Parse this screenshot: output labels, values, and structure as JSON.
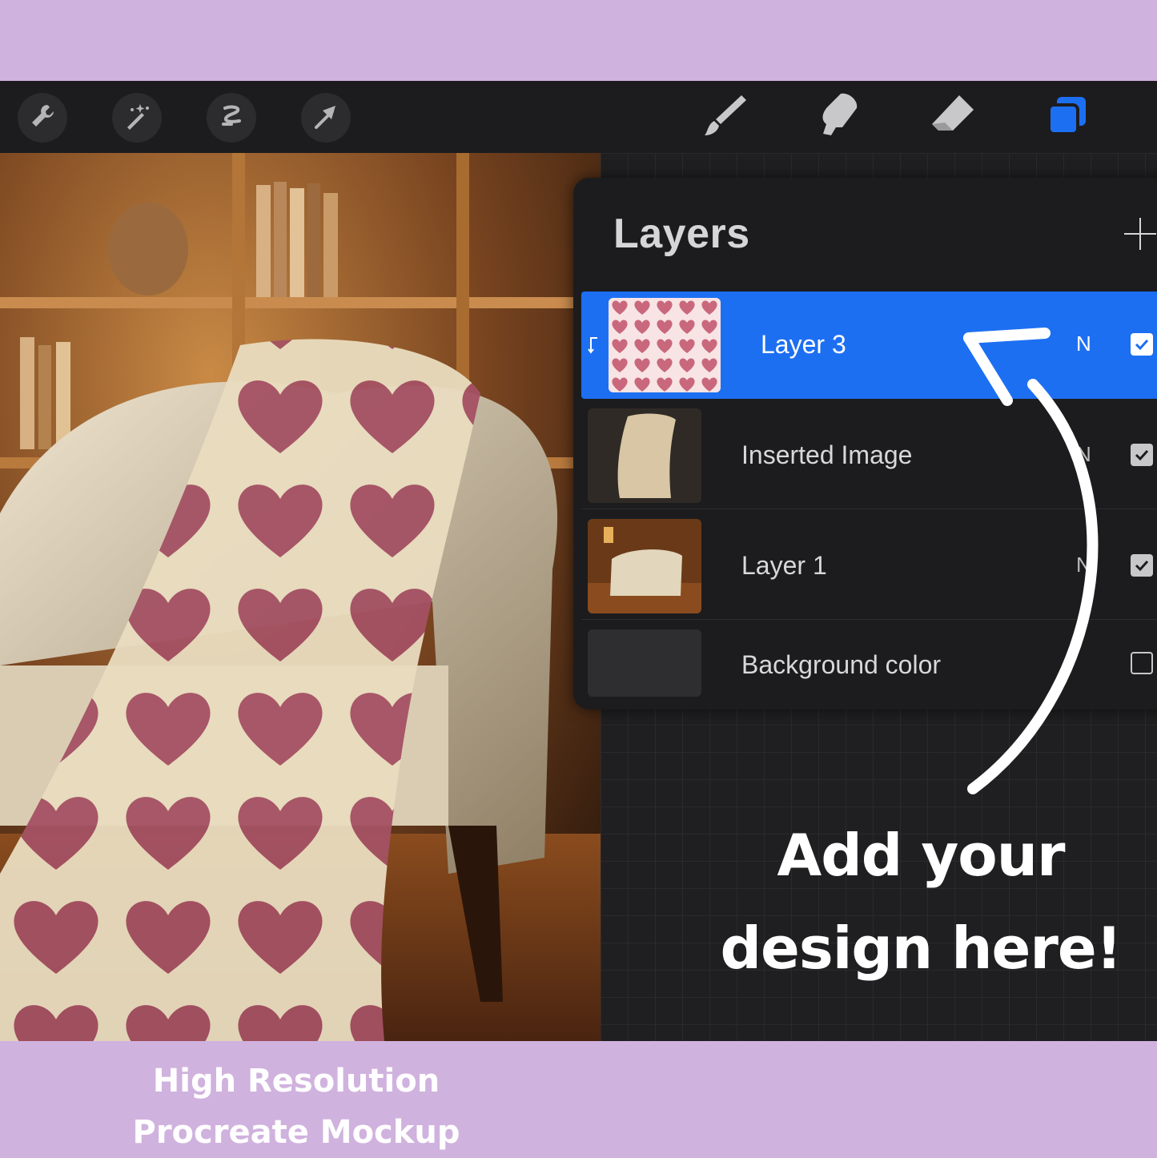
{
  "toolbar": {
    "left_tools": [
      {
        "icon": "wrench-icon"
      },
      {
        "icon": "magic-wand-icon"
      },
      {
        "icon": "selection-icon"
      },
      {
        "icon": "transform-arrow-icon"
      }
    ],
    "right_tools": [
      {
        "icon": "brush-icon"
      },
      {
        "icon": "smudge-icon"
      },
      {
        "icon": "eraser-icon"
      },
      {
        "icon": "layers-icon",
        "active": true
      }
    ],
    "accent_color": "#1d6ff2"
  },
  "layers_panel": {
    "title": "Layers",
    "add_icon": "plus-icon",
    "layers": [
      {
        "name": "Layer 3",
        "blend": "N",
        "visible": true,
        "selected": true,
        "clipping": true
      },
      {
        "name": "Inserted Image",
        "blend": "N",
        "visible": true,
        "selected": false
      },
      {
        "name": "Layer 1",
        "blend": "N",
        "visible": true,
        "selected": false
      },
      {
        "name": "Background color",
        "blend": "",
        "visible": false,
        "selected": false
      }
    ]
  },
  "callout": {
    "line1": "Add your",
    "line2": "design here!"
  },
  "caption": {
    "line1": "High Resolution",
    "line2": "Procreate Mockup"
  },
  "colors": {
    "banner": "#d0b2de",
    "panel": "#1c1c1e",
    "heart": "#a55566",
    "blanket": "#e8dcc0"
  }
}
